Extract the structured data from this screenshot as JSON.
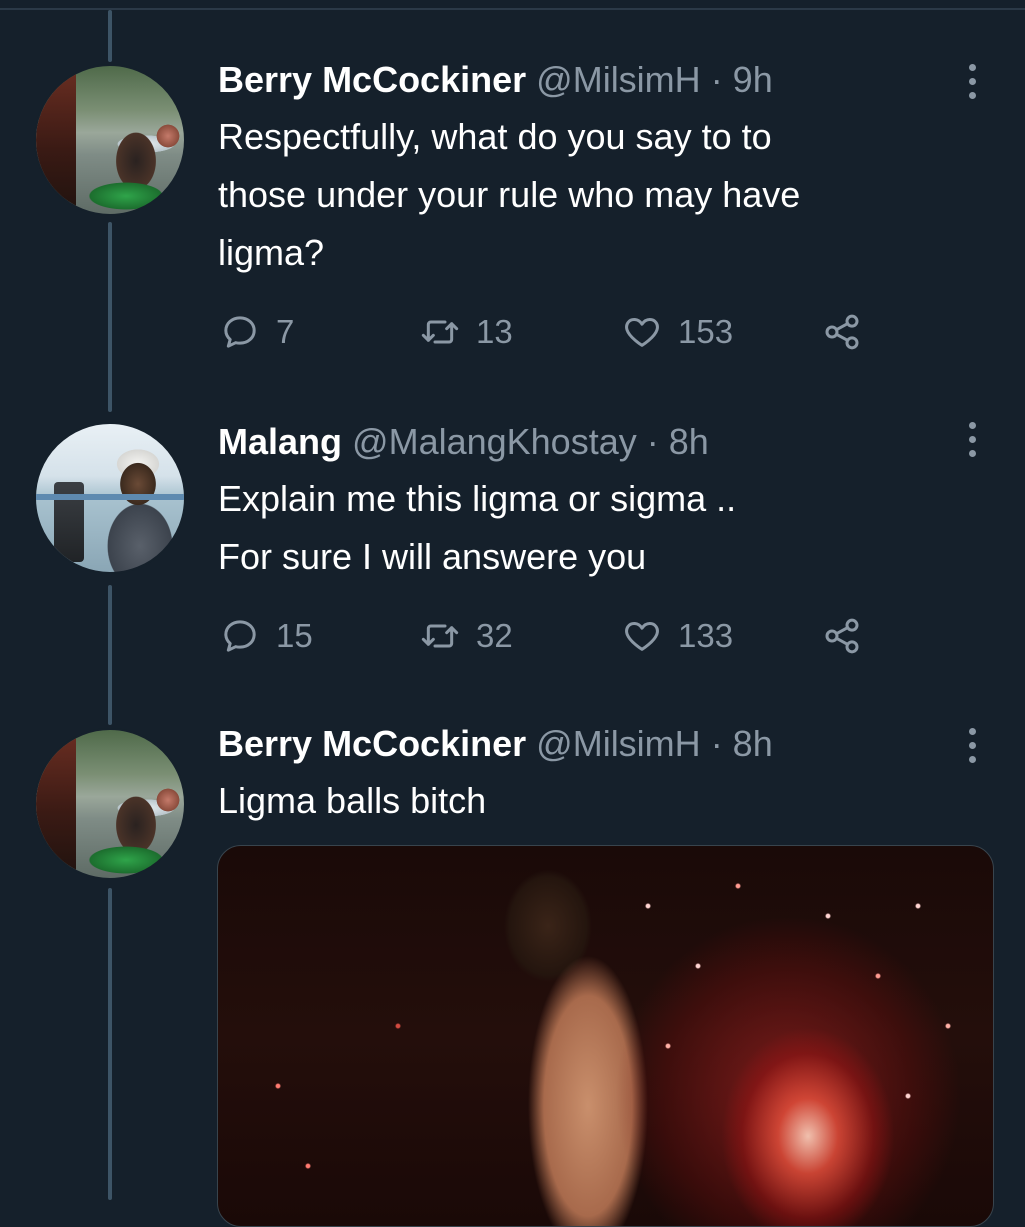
{
  "tweets": [
    {
      "name": "Berry McCockiner",
      "handle": "@MilsimH",
      "time": "· 9h",
      "text_lines": [
        "Respectfully, what do you say to to",
        "those under your rule who may have",
        "ligma?"
      ],
      "replies": "7",
      "retweets": "13",
      "likes": "153"
    },
    {
      "name": "Malang",
      "handle": "@MalangKhostay",
      "time": "· 8h",
      "text_lines": [
        "Explain me this ligma or sigma ..",
        "For sure I will answere you"
      ],
      "replies": "15",
      "retweets": "32",
      "likes": "133"
    },
    {
      "name": "Berry McCockiner",
      "handle": "@MilsimH",
      "time": "· 8h",
      "text_lines": [
        "Ligma balls bitch"
      ]
    }
  ],
  "icons": {
    "reply": "speech-bubble-icon",
    "retweet": "retweet-arrows-icon",
    "like": "heart-icon",
    "share": "share-nodes-icon",
    "more": "three-dots-vertical-icon"
  },
  "colors": {
    "background": "#15202b",
    "text_primary": "#ffffff",
    "text_secondary": "#8b98a5",
    "thread_line": "#3d5466"
  }
}
